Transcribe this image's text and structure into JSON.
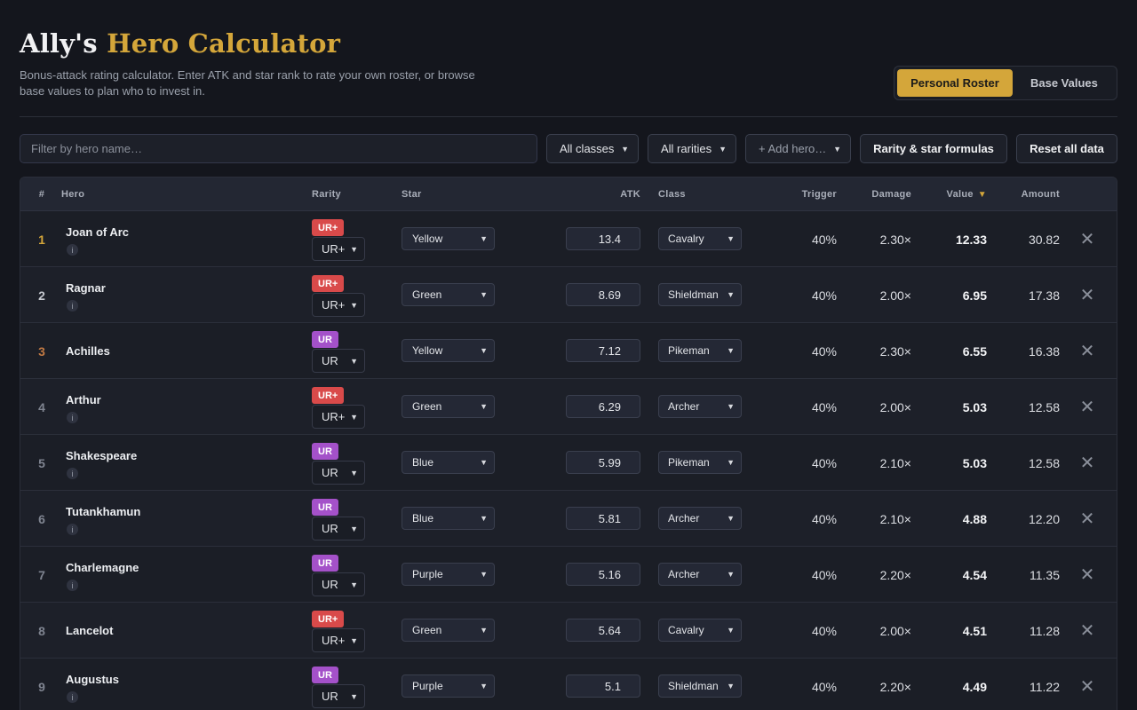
{
  "header": {
    "title_main": "Ally's",
    "title_accent": "Hero Calculator",
    "subtitle": "Bonus-attack rating calculator. Enter ATK and star rank to rate your own roster, or browse base values to plan who to invest in."
  },
  "mode_toggle": {
    "active": "Personal Roster",
    "inactive": "Base Values"
  },
  "controls": {
    "filter_placeholder": "Filter by hero name…",
    "class_filter": "All classes",
    "rarity_filter": "All rarities",
    "add_hero": "+ Add hero…",
    "formulas_button": "Rarity & star formulas",
    "reset_button": "Reset all data"
  },
  "table": {
    "headers": {
      "rank": "#",
      "hero": "Hero",
      "rarity": "Rarity",
      "star": "Star",
      "atk": "ATK",
      "class": "Class",
      "trigger": "Trigger",
      "damage": "Damage",
      "value": "Value",
      "amount": "Amount"
    },
    "sort_indicator": "▼",
    "info_label": "i",
    "remove_glyph": "✕",
    "rows": [
      {
        "rank": "1",
        "hero": "Joan of Arc",
        "rarity": "UR+",
        "star": "Yellow",
        "atk": "13.4",
        "class": "Cavalry",
        "trigger": "40%",
        "damage": "2.30×",
        "value": "12.33",
        "amount": "30.82",
        "info": true
      },
      {
        "rank": "2",
        "hero": "Ragnar",
        "rarity": "UR+",
        "star": "Green",
        "atk": "8.69",
        "class": "Shieldman",
        "trigger": "40%",
        "damage": "2.00×",
        "value": "6.95",
        "amount": "17.38",
        "info": true
      },
      {
        "rank": "3",
        "hero": "Achilles",
        "rarity": "UR",
        "star": "Yellow",
        "atk": "7.12",
        "class": "Pikeman",
        "trigger": "40%",
        "damage": "2.30×",
        "value": "6.55",
        "amount": "16.38",
        "info": false
      },
      {
        "rank": "4",
        "hero": "Arthur",
        "rarity": "UR+",
        "star": "Green",
        "atk": "6.29",
        "class": "Archer",
        "trigger": "40%",
        "damage": "2.00×",
        "value": "5.03",
        "amount": "12.58",
        "info": true
      },
      {
        "rank": "5",
        "hero": "Shakespeare",
        "rarity": "UR",
        "star": "Blue",
        "atk": "5.99",
        "class": "Pikeman",
        "trigger": "40%",
        "damage": "2.10×",
        "value": "5.03",
        "amount": "12.58",
        "info": true
      },
      {
        "rank": "6",
        "hero": "Tutankhamun",
        "rarity": "UR",
        "star": "Blue",
        "atk": "5.81",
        "class": "Archer",
        "trigger": "40%",
        "damage": "2.10×",
        "value": "4.88",
        "amount": "12.20",
        "info": true
      },
      {
        "rank": "7",
        "hero": "Charlemagne",
        "rarity": "UR",
        "star": "Purple",
        "atk": "5.16",
        "class": "Archer",
        "trigger": "40%",
        "damage": "2.20×",
        "value": "4.54",
        "amount": "11.35",
        "info": true
      },
      {
        "rank": "8",
        "hero": "Lancelot",
        "rarity": "UR+",
        "star": "Green",
        "atk": "5.64",
        "class": "Cavalry",
        "trigger": "40%",
        "damage": "2.00×",
        "value": "4.51",
        "amount": "11.28",
        "info": false
      },
      {
        "rank": "9",
        "hero": "Augustus",
        "rarity": "UR",
        "star": "Purple",
        "atk": "5.1",
        "class": "Shieldman",
        "trigger": "40%",
        "damage": "2.20×",
        "value": "4.49",
        "amount": "11.22",
        "info": true
      }
    ]
  }
}
